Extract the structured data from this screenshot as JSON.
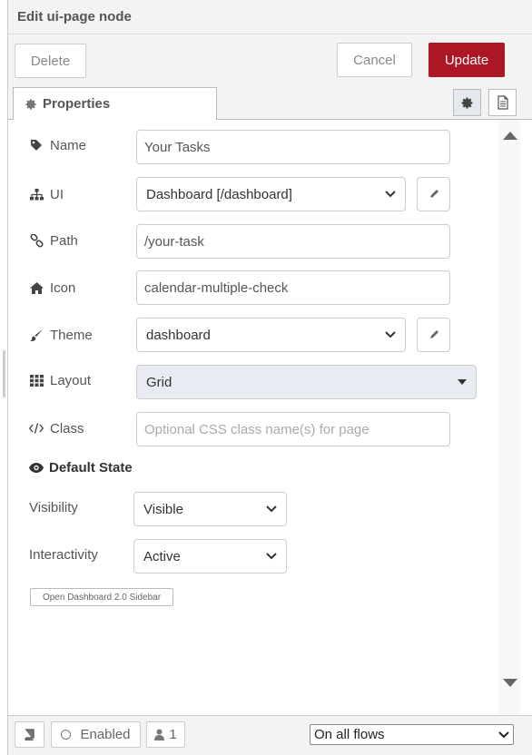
{
  "window": {
    "title": "Edit ui-page node"
  },
  "toolbar": {
    "delete_label": "Delete",
    "cancel_label": "Cancel",
    "update_label": "Update"
  },
  "tabs": {
    "properties_label": "Properties"
  },
  "form": {
    "name": {
      "label": "Name",
      "value": "Your Tasks",
      "icon": "tag-icon"
    },
    "ui": {
      "label": "UI",
      "value": "Dashboard [/dashboard]",
      "icon": "sitemap-icon"
    },
    "path": {
      "label": "Path",
      "value": "/your-task",
      "icon": "link-icon"
    },
    "icon_field": {
      "label": "Icon",
      "value": "calendar-multiple-check",
      "icon": "home-icon"
    },
    "theme": {
      "label": "Theme",
      "value": "dashboard",
      "icon": "paintbrush-icon"
    },
    "layout": {
      "label": "Layout",
      "value": "Grid",
      "icon": "grid-icon"
    },
    "class": {
      "label": "Class",
      "placeholder": "Optional CSS class name(s) for page",
      "icon": "code-icon"
    }
  },
  "default_state": {
    "heading": "Default State",
    "visibility": {
      "label": "Visibility",
      "value": "Visible"
    },
    "interactivity": {
      "label": "Interactivity",
      "value": "Active"
    }
  },
  "sidebar_button_label": "Open Dashboard 2.0 Sidebar",
  "footer": {
    "enabled_label": "Enabled",
    "users_count": "1",
    "flows_select": "On all flows"
  },
  "colors": {
    "accent": "#ad1625",
    "panel": "#f3f3f3",
    "select_grey": "#e9ebf3"
  }
}
